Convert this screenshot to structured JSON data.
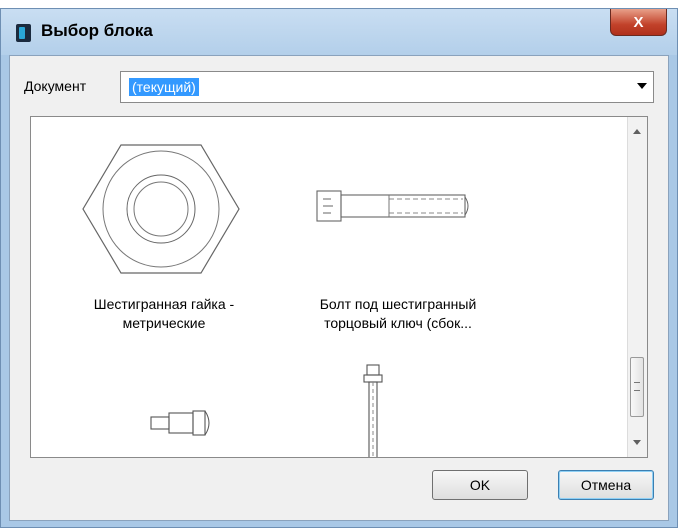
{
  "dialog": {
    "title": "Выбор блока",
    "close_label": "X"
  },
  "document": {
    "label": "Документ",
    "value": "(текущий)"
  },
  "blocks": [
    {
      "line1": "Шестигранная гайка -",
      "line2": "метрические"
    },
    {
      "line1": "Болт под шестигранный",
      "line2": "торцовый ключ (сбок..."
    }
  ],
  "buttons": {
    "ok": "OK",
    "cancel": "Отмена"
  },
  "colors": {
    "frame": "#a9c8e6",
    "selection": "#3399ff",
    "close": "#c2422a"
  }
}
